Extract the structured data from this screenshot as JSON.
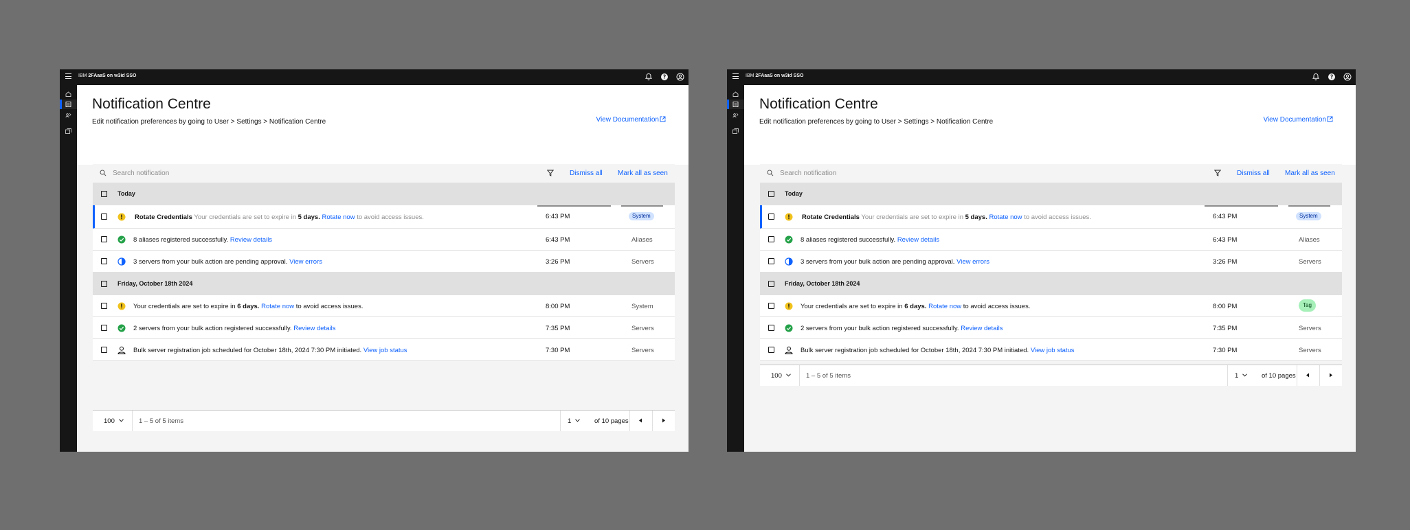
{
  "app": {
    "brand_prefix": "IBM",
    "brand_name": "2FAaaS on w3id SSO"
  },
  "header": {
    "title": "Notification Centre",
    "subtitle": "Edit notification preferences by going to User > Settings > Notification Centre",
    "doc_link": "View Documentation"
  },
  "toolbar": {
    "search_placeholder": "Search notification",
    "dismiss_all": "Dismiss all",
    "mark_all_seen": "Mark all as seen"
  },
  "groups": {
    "today": "Today",
    "friday": "Friday, October 18th 2024"
  },
  "rows": {
    "r1": {
      "title": "Rotate Credentials",
      "text_before": "Your credentials are set to expire in",
      "bold": "5 days.",
      "link": "Rotate now",
      "text_after": "to avoid access issues.",
      "time": "6:43 PM",
      "tag": "System"
    },
    "r2": {
      "text_before": "8 aliases registered successfully.",
      "link": "Review details",
      "time": "6:43 PM",
      "category": "Aliases"
    },
    "r3": {
      "text_before": "3 servers from your bulk action are pending approval.",
      "link": "View errors",
      "time": "3:26 PM",
      "category": "Servers"
    },
    "r4": {
      "text_before": "Your credentials are set to expire in",
      "bold": "6 days.",
      "link": "Rotate now",
      "text_after": "to avoid access issues.",
      "time": "8:00 PM",
      "category": "System",
      "tag": "Tag"
    },
    "r5": {
      "text_before": "2 servers from your bulk action registered successfully.",
      "link": "Review details",
      "time": "7:35 PM",
      "category": "Servers"
    },
    "r6": {
      "text_before": "Bulk server registration job scheduled for October 18th, 2024 7:30 PM initiated.",
      "link": "View job status",
      "time": "7:30 PM",
      "category": "Servers"
    }
  },
  "pagination": {
    "per_page": "100",
    "range": "1 – 5 of 5 items",
    "page": "1",
    "of_pages": "of 10 pages"
  },
  "colors": {
    "shell": "#161616",
    "accent": "#0f62fe",
    "warning": "#f1c21b",
    "success": "#24a148",
    "system_tag_bg": "#d0e2ff",
    "green_tag_bg": "#a7f0ba"
  },
  "icons": {
    "menu": "hamburger-icon",
    "notifications": "bell-icon",
    "help": "help-icon",
    "user": "user-avatar-icon",
    "search": "search-icon",
    "filter": "filter-icon",
    "warning": "warning-icon",
    "success": "checkmark-icon",
    "pending": "in-progress-icon",
    "job": "user-job-icon",
    "external": "launch-icon"
  }
}
